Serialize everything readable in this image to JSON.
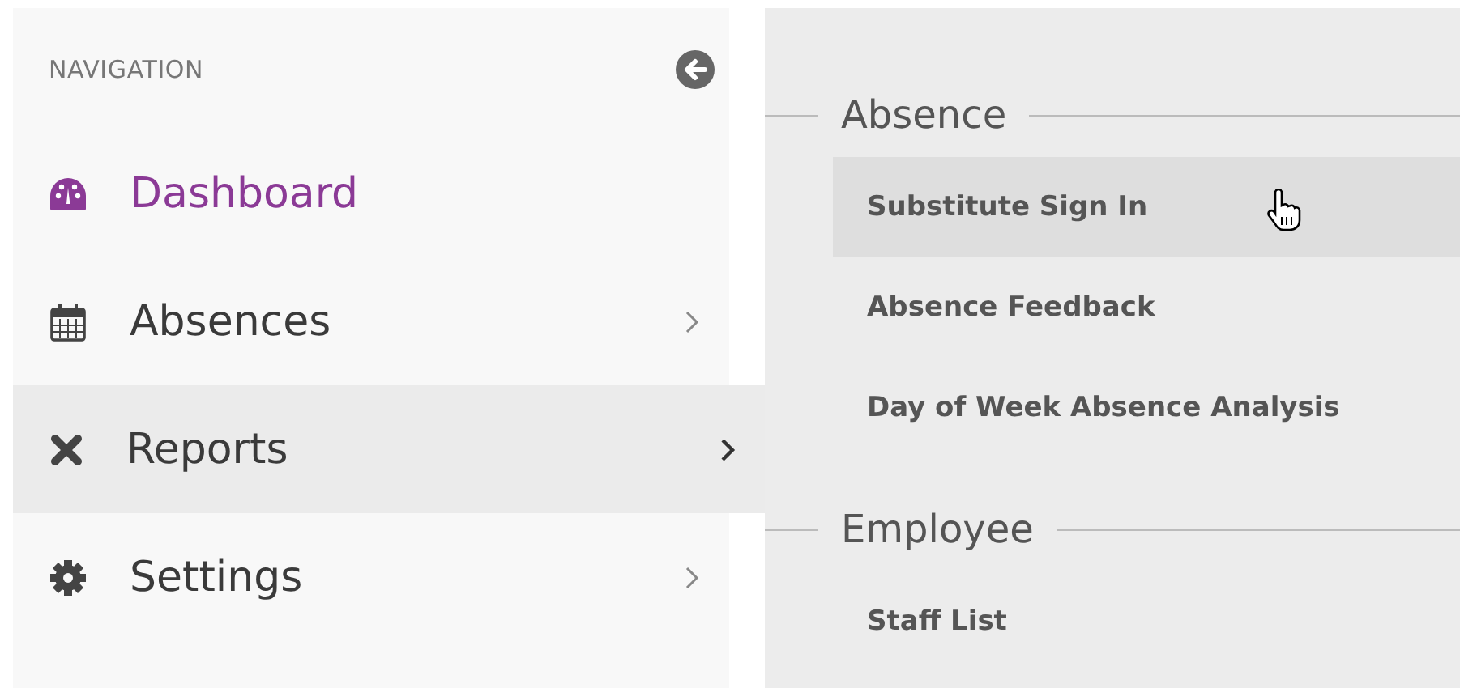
{
  "sidebar": {
    "title": "NAVIGATION",
    "items": [
      {
        "label": "Dashboard",
        "active": true,
        "selected": false,
        "has_children": false
      },
      {
        "label": "Absences",
        "active": false,
        "selected": false,
        "has_children": true
      },
      {
        "label": "Reports",
        "active": false,
        "selected": true,
        "has_children": true
      },
      {
        "label": "Settings",
        "active": false,
        "selected": false,
        "has_children": true
      }
    ]
  },
  "submenu": {
    "groups": [
      {
        "heading": "Absence",
        "items": [
          {
            "label": "Substitute Sign In",
            "hovered": true
          },
          {
            "label": "Absence Feedback",
            "hovered": false
          },
          {
            "label": "Day of Week Absence Analysis",
            "hovered": false
          }
        ]
      },
      {
        "heading": "Employee",
        "items": [
          {
            "label": "Staff List",
            "hovered": false
          }
        ]
      }
    ]
  }
}
